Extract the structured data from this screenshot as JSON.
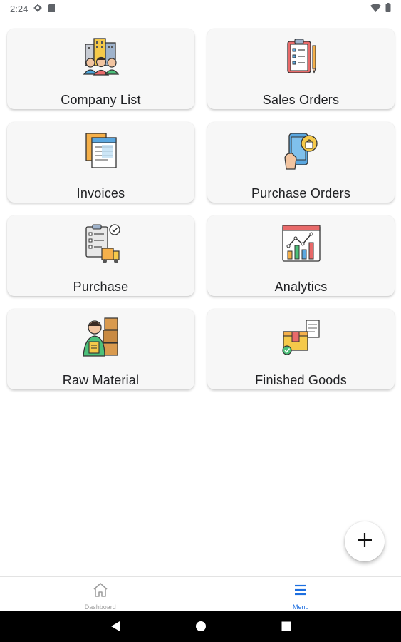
{
  "status_bar": {
    "time": "2:24",
    "icons": [
      "settings-icon",
      "sim-card-icon",
      "wifi-icon",
      "battery-icon"
    ]
  },
  "menu_cards": [
    {
      "label": "Company List",
      "icon": "company-list-icon"
    },
    {
      "label": "Sales Orders",
      "icon": "sales-orders-icon"
    },
    {
      "label": "Invoices",
      "icon": "invoices-icon"
    },
    {
      "label": "Purchase Orders",
      "icon": "purchase-orders-icon"
    },
    {
      "label": "Purchase",
      "icon": "purchase-icon"
    },
    {
      "label": "Analytics",
      "icon": "analytics-icon"
    },
    {
      "label": "Raw Material",
      "icon": "raw-material-icon"
    },
    {
      "label": "Finished Goods",
      "icon": "finished-goods-icon"
    }
  ],
  "fab": {
    "icon": "plus-icon"
  },
  "bottom_nav": {
    "items": [
      {
        "label": "Dashboard",
        "icon": "home-icon",
        "active": false
      },
      {
        "label": "Menu",
        "icon": "menu-icon",
        "active": true
      }
    ]
  },
  "system_nav": {
    "buttons": [
      "back-icon",
      "home-circle-icon",
      "recents-icon"
    ]
  },
  "colors": {
    "card_bg": "#f7f7f7",
    "active_nav": "#1e6fe0",
    "inactive_nav": "#9e9e9e",
    "system_bar": "#000000"
  }
}
